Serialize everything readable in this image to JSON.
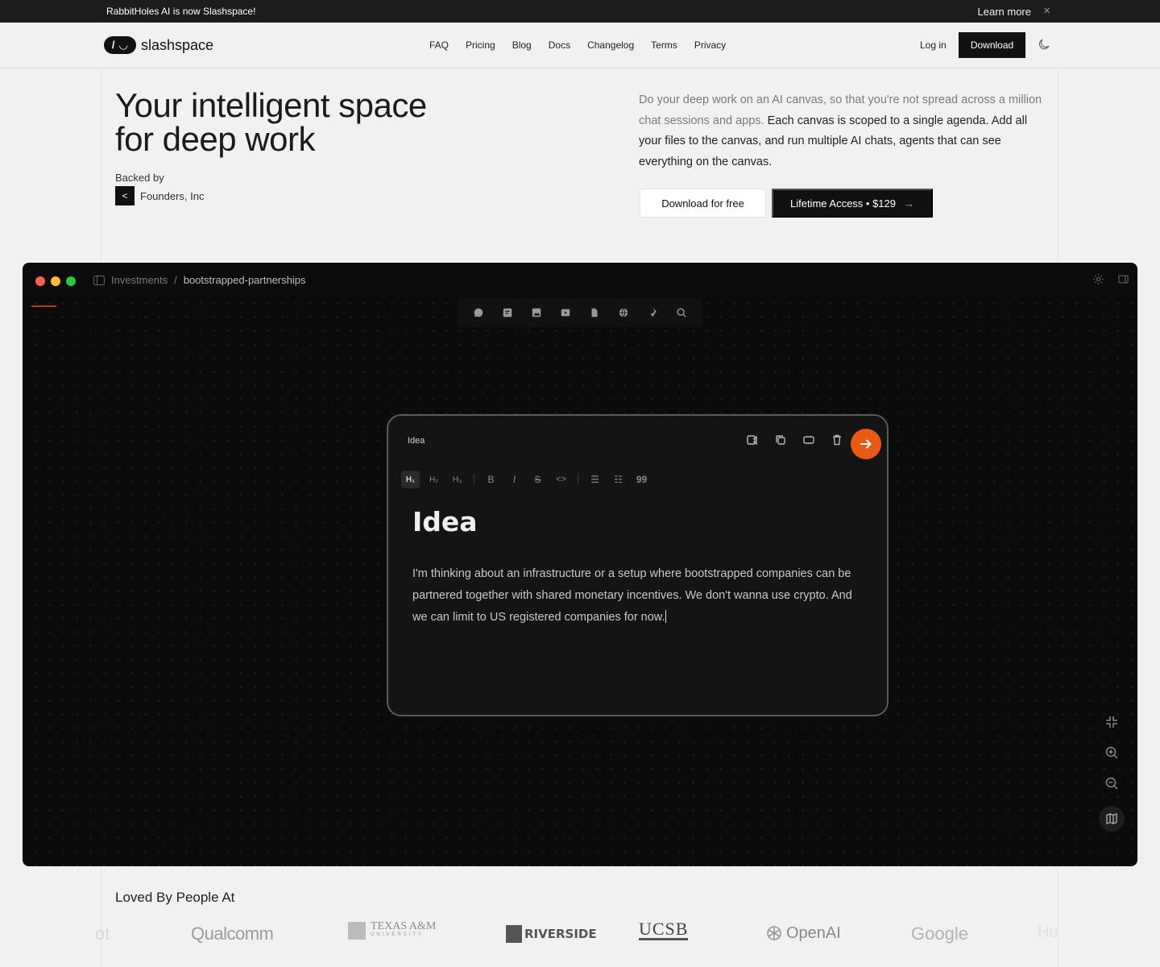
{
  "announcement": {
    "message": "RabbitHoles AI is now Slashspace!",
    "learn_more": "Learn more",
    "close": "×"
  },
  "nav": {
    "logo_mark": "/ ◡",
    "logo_text": "slashspace",
    "menu": [
      "FAQ",
      "Pricing",
      "Blog",
      "Docs",
      "Changelog",
      "Terms",
      "Privacy"
    ],
    "login": "Log in",
    "download": "Download"
  },
  "hero": {
    "title_line1": "Your intelligent space",
    "title_line2": "for deep work",
    "backed_by": "Backed by",
    "backer_icon": "<",
    "backer": "Founders, Inc",
    "desc_muted": "Do your deep work on an AI canvas, so that you're not spread across a million chat sessions and apps.",
    "desc_main": "Each canvas is scoped to a single agenda. Add all your files to the canvas, and run multiple AI chats, agents that can see everything on the canvas.",
    "btn_free": "Download for free",
    "btn_lifetime": "Lifetime Access • $129",
    "btn_lifetime_arrow": "→"
  },
  "app": {
    "breadcrumb_parent": "Investments",
    "breadcrumb_sep": "/",
    "breadcrumb_current": "bootstrapped-partnerships",
    "colors": {
      "red": "#ff5f57",
      "yellow": "#febc2e",
      "green": "#28c840",
      "accent": "#e85a12"
    },
    "toolbar_icons": [
      "chat-icon",
      "note-icon",
      "image-icon",
      "video-icon",
      "file-icon",
      "globe-icon",
      "pin-icon",
      "search-icon"
    ],
    "card": {
      "label": "Idea",
      "heading": "Idea",
      "body": "I'm thinking about an infrastructure or a setup where bootstrapped companies can be partnered together with shared monetary incentives. We don't wanna use crypto. And we can limit to US registered companies for now.",
      "format": {
        "h1": "H₁",
        "h2": "H₂",
        "h3": "H₃",
        "bold": "B",
        "italic": "I",
        "strike": "S",
        "code": "<>",
        "bullet": "☰",
        "numbered": "☷",
        "quote": "99"
      }
    }
  },
  "loved": {
    "title": "Loved By People At",
    "logos": [
      "ot",
      "Qualcomm",
      "TEXAS A&M",
      "UNIVERSITY",
      "RIVERSIDE",
      "UCSB",
      "OpenAI",
      "Google",
      "Hu"
    ]
  }
}
